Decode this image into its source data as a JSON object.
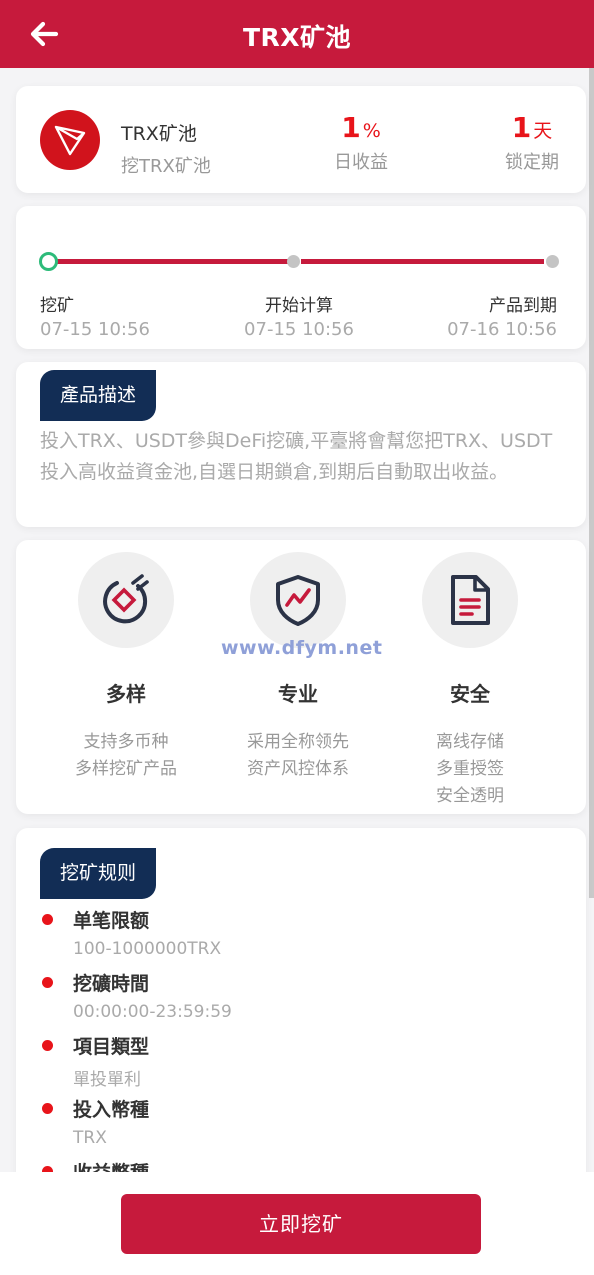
{
  "header": {
    "title": "TRX矿池",
    "back_icon": "arrow-left-icon"
  },
  "summary": {
    "logo_icon": "tron-logo-icon",
    "name": "TRX矿池",
    "subtitle": "挖TRX矿池",
    "daily_yield": {
      "value": "1",
      "unit": "%",
      "label": "日收益"
    },
    "lock_period": {
      "value": "1",
      "unit": "天",
      "label": "锁定期"
    }
  },
  "timeline": {
    "steps": [
      {
        "label": "挖矿",
        "time": "07-15 10:56"
      },
      {
        "label": "开始计算",
        "time": "07-15 10:56"
      },
      {
        "label": "产品到期",
        "time": "07-16 10:56"
      }
    ]
  },
  "description": {
    "badge": "產品描述",
    "text": "投入TRX、USDT參與DeFi挖礦,平臺將會幫您把TRX、USDT投入高收益資金池,自選日期鎖倉,到期后自動取出收益。"
  },
  "watermark": "www.dfym.net",
  "features": [
    {
      "icon": "diversity-icon",
      "title": "多样",
      "desc": [
        "支持多币种",
        "多样挖矿产品"
      ]
    },
    {
      "icon": "shield-chart-icon",
      "title": "专业",
      "desc": [
        "采用全称领先",
        "资产风控体系"
      ]
    },
    {
      "icon": "document-icon",
      "title": "安全",
      "desc": [
        "离线存储",
        "多重授签",
        "安全透明"
      ]
    }
  ],
  "rules": {
    "badge": "挖矿规则",
    "items": [
      {
        "title": "单笔限额",
        "value": "100-1000000TRX"
      },
      {
        "title": "挖礦時間",
        "value": "00:00:00-23:59:59"
      },
      {
        "title": "項目類型",
        "value": "單投單利"
      },
      {
        "title": "投入幣種",
        "value": "TRX"
      },
      {
        "title": "收益幣種",
        "value": ""
      }
    ]
  },
  "cta": {
    "label": "立即挖矿"
  },
  "colors": {
    "primary": "#c61a3c",
    "accent_red": "#e8141a",
    "badge_navy": "#122d55",
    "timeline_start": "#2dbb7a"
  }
}
